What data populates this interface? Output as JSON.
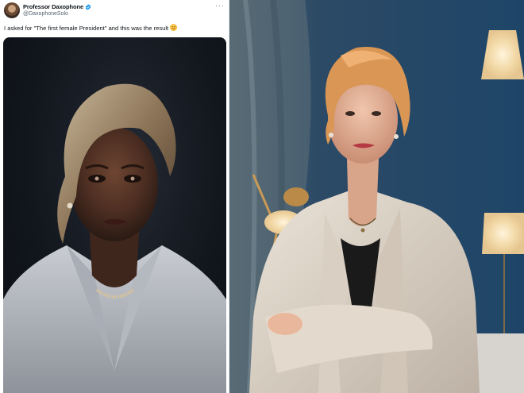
{
  "tweet": {
    "display_name": "Professor Daxophone",
    "handle": "@DaxophoneSolo",
    "text": "I asked for \"The first female President\" and this was the result",
    "emoji": "slightly-smiling-face-icon",
    "more_icon": "more-horizontal-icon",
    "verified_icon": "verified-badge-icon",
    "colors": {
      "text": "#0f1419",
      "muted": "#536471",
      "verified": "#1d9bf0"
    }
  },
  "media": {
    "left_image": "ai-generated-portrait",
    "right_image": "photo-portrait"
  }
}
